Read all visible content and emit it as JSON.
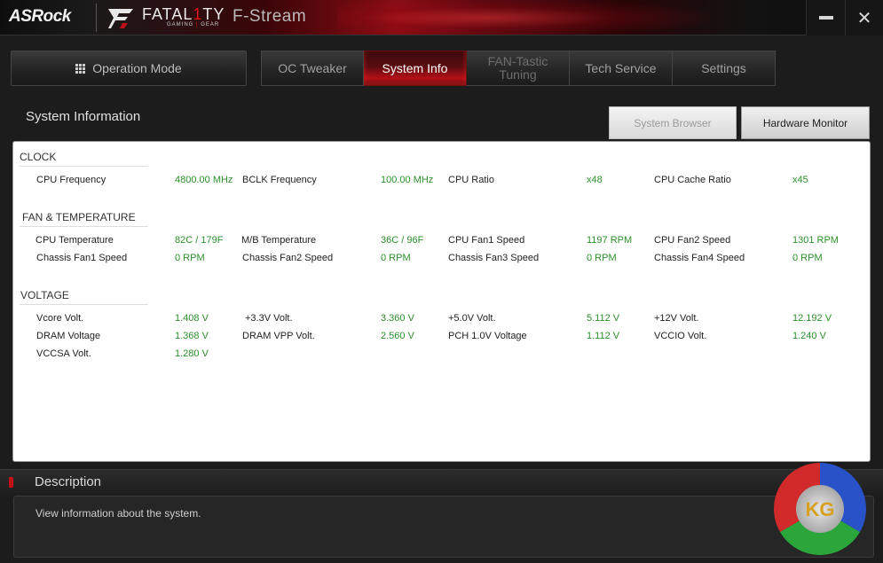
{
  "titlebar": {
    "brand": "ASRock",
    "fatal1ty_prefix": "FATAL",
    "fatal1ty_one": "1",
    "fatal1ty_suffix": "TY",
    "sub_left": "GAMING",
    "sub_sep": "|",
    "sub_right": "GEAR",
    "app_title": "F-Stream",
    "close_glyph": "✕"
  },
  "nav": {
    "operation_mode": "Operation Mode",
    "tabs": [
      "OC Tweaker",
      "System Info",
      "FAN-Tastic\nTuning",
      "Tech Service",
      "Settings"
    ],
    "active_tab": "System Info"
  },
  "section": {
    "title": "System Information",
    "system_browser": "System Browser",
    "hardware_monitor": "Hardware Monitor"
  },
  "clock": {
    "title": "CLOCK",
    "items": [
      {
        "label": "CPU Frequency",
        "value": "4800.00 MHz"
      },
      {
        "label": "BCLK Frequency",
        "value": "100.00 MHz"
      },
      {
        "label": "CPU Ratio",
        "value": "x48"
      },
      {
        "label": "CPU Cache Ratio",
        "value": "x45"
      }
    ]
  },
  "fan": {
    "title": "FAN & TEMPERATURE",
    "items": [
      {
        "label": "CPU Temperature",
        "value": "82C / 179F"
      },
      {
        "label": "M/B Temperature",
        "value": "36C / 96F"
      },
      {
        "label": "CPU Fan1 Speed",
        "value": "1197 RPM"
      },
      {
        "label": "CPU Fan2 Speed",
        "value": "1301 RPM"
      },
      {
        "label": "Chassis Fan1 Speed",
        "value": "0 RPM"
      },
      {
        "label": "Chassis Fan2 Speed",
        "value": "0 RPM"
      },
      {
        "label": "Chassis Fan3 Speed",
        "value": "0 RPM"
      },
      {
        "label": "Chassis Fan4 Speed",
        "value": "0 RPM"
      }
    ]
  },
  "voltage": {
    "title": "VOLTAGE",
    "items": [
      {
        "label": "Vcore Volt.",
        "value": "1.408 V"
      },
      {
        "label": "+3.3V Volt.",
        "value": "3.360 V"
      },
      {
        "label": "+5.0V Volt.",
        "value": "5.112 V"
      },
      {
        "label": "+12V Volt.",
        "value": "12.192 V"
      },
      {
        "label": "DRAM Voltage",
        "value": "1.368 V"
      },
      {
        "label": "DRAM VPP Volt.",
        "value": "2.560 V"
      },
      {
        "label": "PCH 1.0V Voltage",
        "value": "1.112 V"
      },
      {
        "label": "VCCIO Volt.",
        "value": "1.240 V"
      },
      {
        "label": "VCCSA Volt.",
        "value": "1.280 V"
      }
    ]
  },
  "description": {
    "title": "Description",
    "text": "View information about the system."
  },
  "watermark": {
    "text": "KG"
  },
  "colors": {
    "accent_red": "#c01018",
    "value_green": "#2b8f2b"
  }
}
